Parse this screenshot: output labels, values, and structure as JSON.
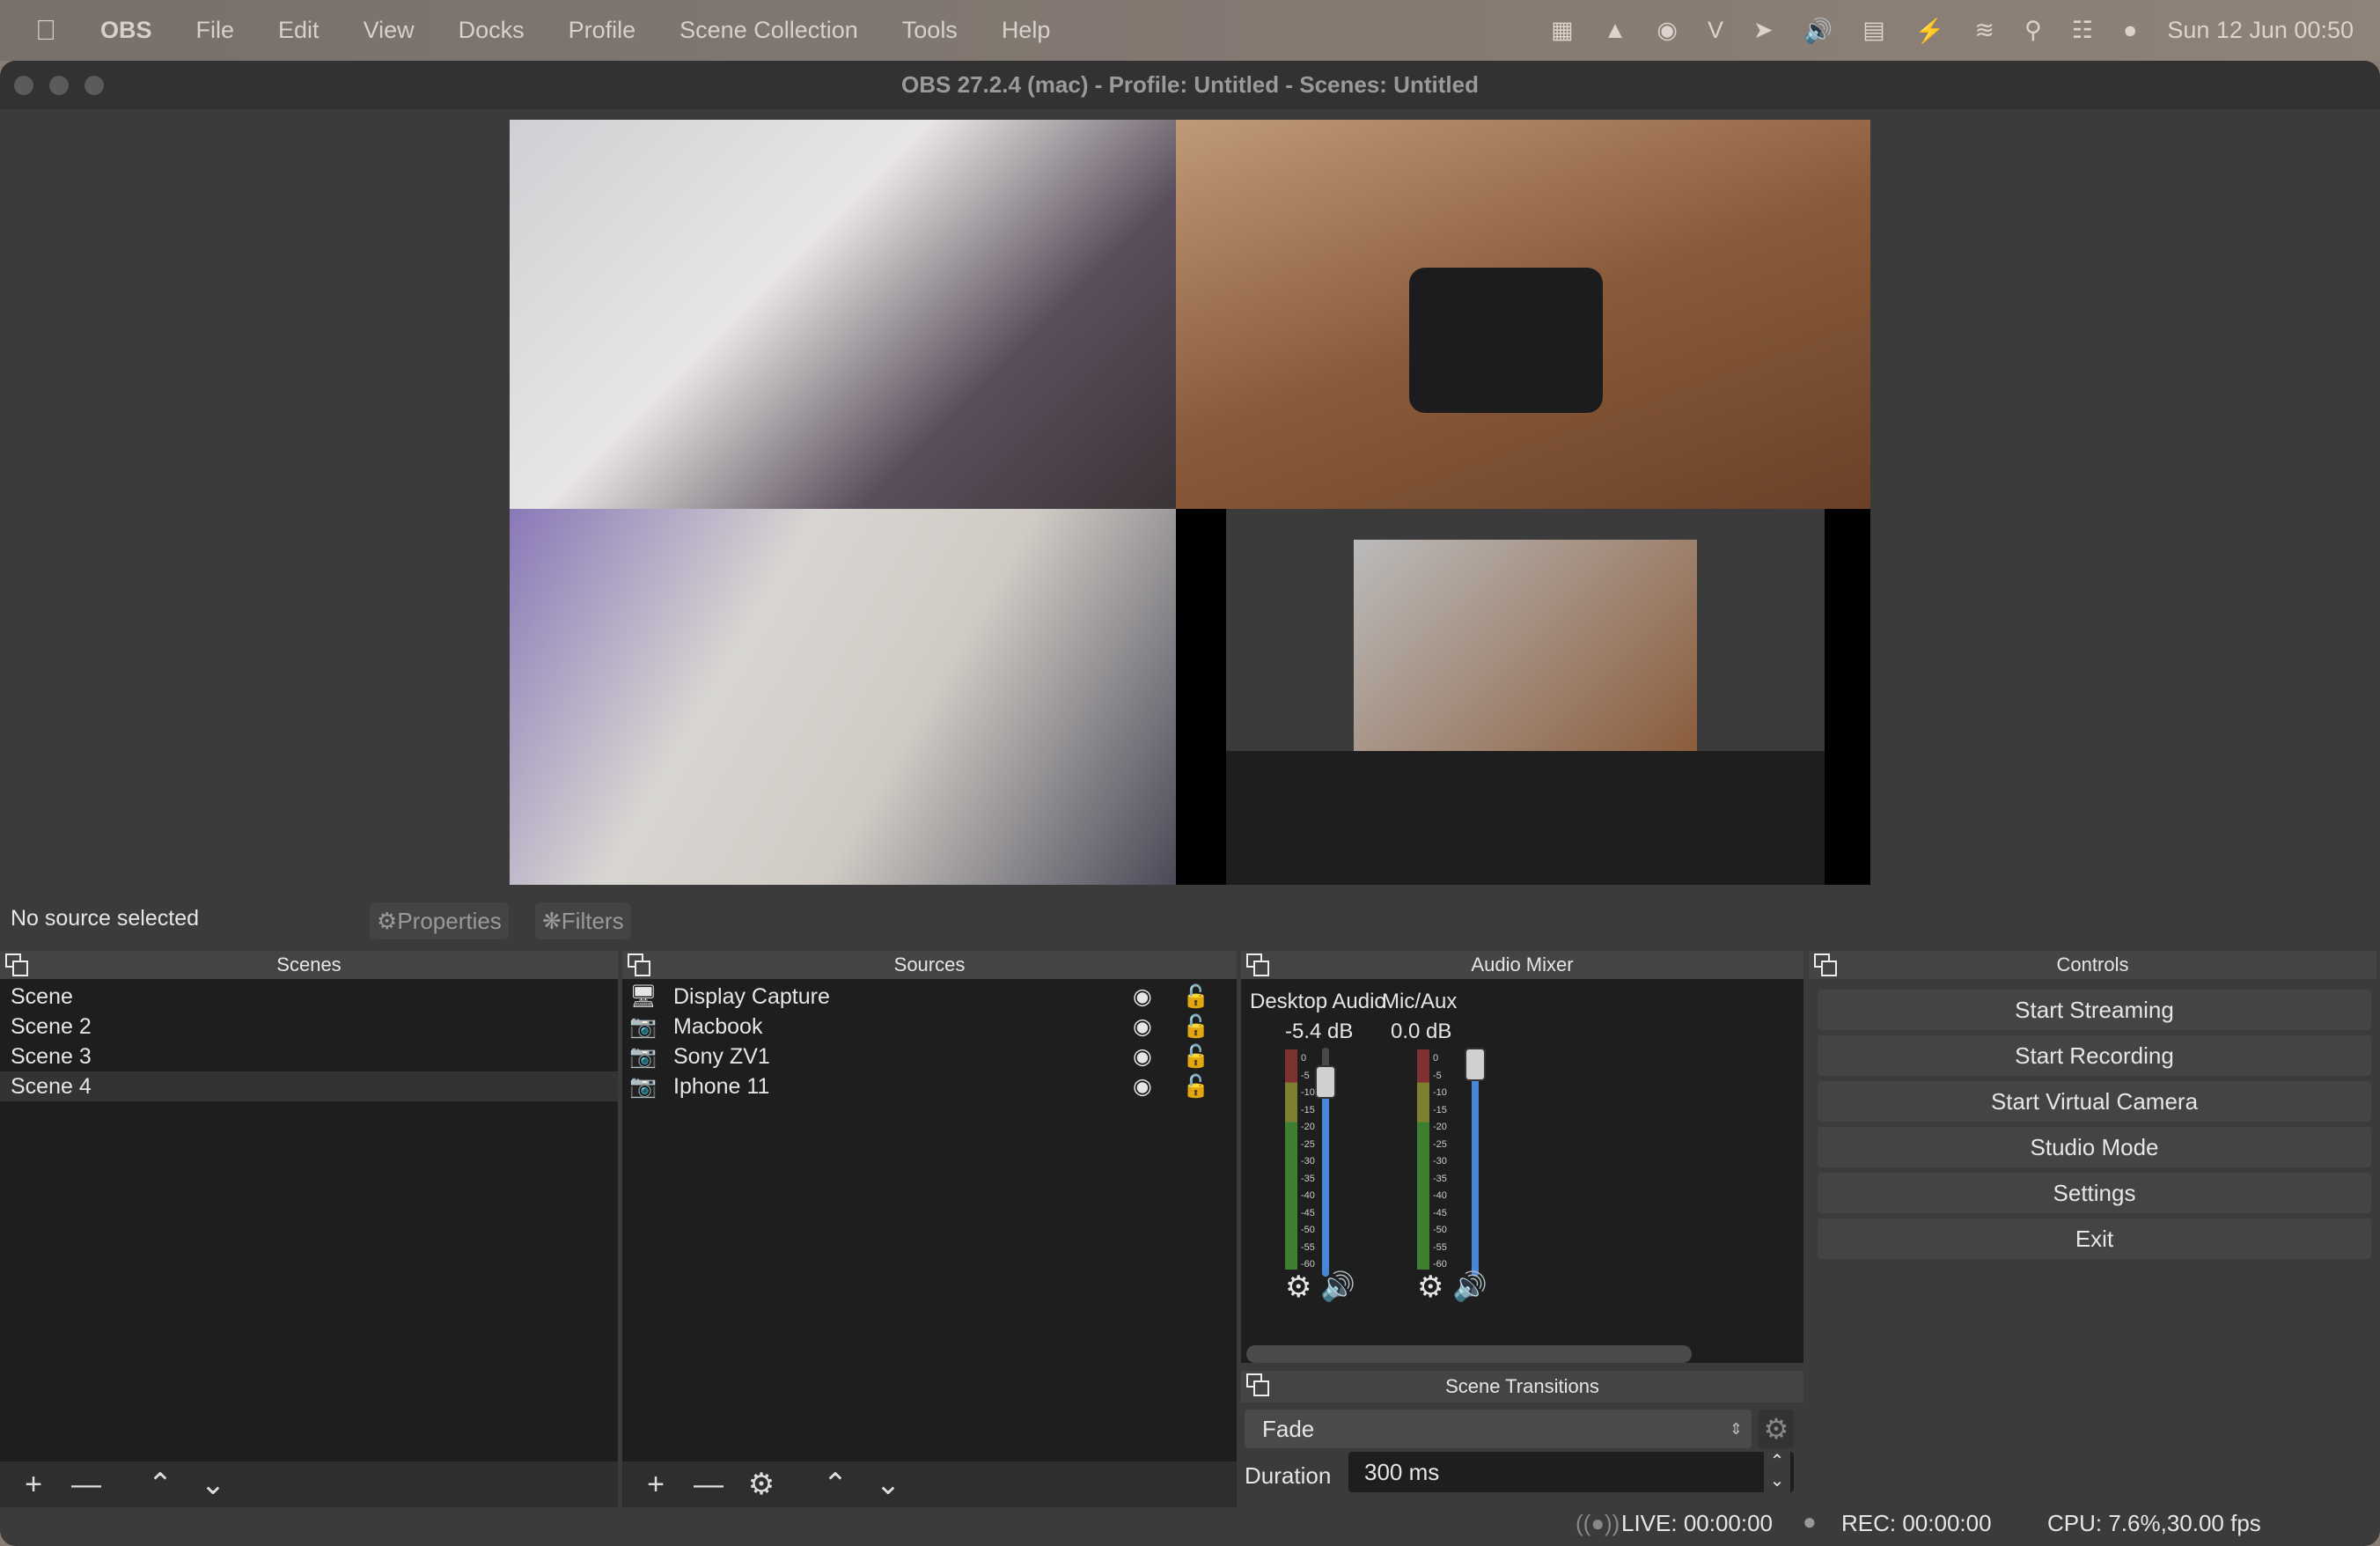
{
  "menubar": {
    "items": [
      "OBS",
      "File",
      "Edit",
      "View",
      "Docks",
      "Profile",
      "Scene Collection",
      "Tools",
      "Help"
    ],
    "clock": "Sun 12 Jun  00:50"
  },
  "window": {
    "title": "OBS 27.2.4 (mac) - Profile: Untitled - Scenes: Untitled"
  },
  "source_bar": {
    "status": "No source selected",
    "properties": "Properties",
    "filters": "Filters"
  },
  "scenes": {
    "title": "Scenes",
    "items": [
      "Scene",
      "Scene 2",
      "Scene 3",
      "Scene 4"
    ],
    "selected": "Scene 4"
  },
  "sources": {
    "title": "Sources",
    "items": [
      {
        "name": "Display Capture",
        "icon": "monitor-icon"
      },
      {
        "name": "Macbook",
        "icon": "camera-icon"
      },
      {
        "name": "Sony ZV1",
        "icon": "camera-icon"
      },
      {
        "name": "Iphone 11",
        "icon": "camera-icon"
      }
    ]
  },
  "audio_mixer": {
    "title": "Audio Mixer",
    "channels": [
      {
        "name": "Desktop Audio",
        "db": "-5.4 dB",
        "volume_db": -5.4
      },
      {
        "name": "Mic/Aux",
        "db": "0.0 dB",
        "volume_db": 0.0
      }
    ],
    "scale": [
      "0",
      "-5",
      "-10",
      "-15",
      "-20",
      "-25",
      "-30",
      "-35",
      "-40",
      "-45",
      "-50",
      "-55",
      "-60"
    ]
  },
  "transitions": {
    "title": "Scene Transitions",
    "selected": "Fade",
    "duration_label": "Duration",
    "duration": "300 ms"
  },
  "controls": {
    "title": "Controls",
    "buttons": [
      "Start Streaming",
      "Start Recording",
      "Start Virtual Camera",
      "Studio Mode",
      "Settings",
      "Exit"
    ]
  },
  "status": {
    "live": "LIVE: 00:00:00",
    "rec": "REC: 00:00:00",
    "cpu": "CPU: 7.6%,30.00 fps"
  },
  "colors": {
    "accent": "#4a86d8",
    "meter_green": "#3f7f32",
    "meter_yellow": "#7f7f32",
    "meter_red": "#7f3232"
  }
}
